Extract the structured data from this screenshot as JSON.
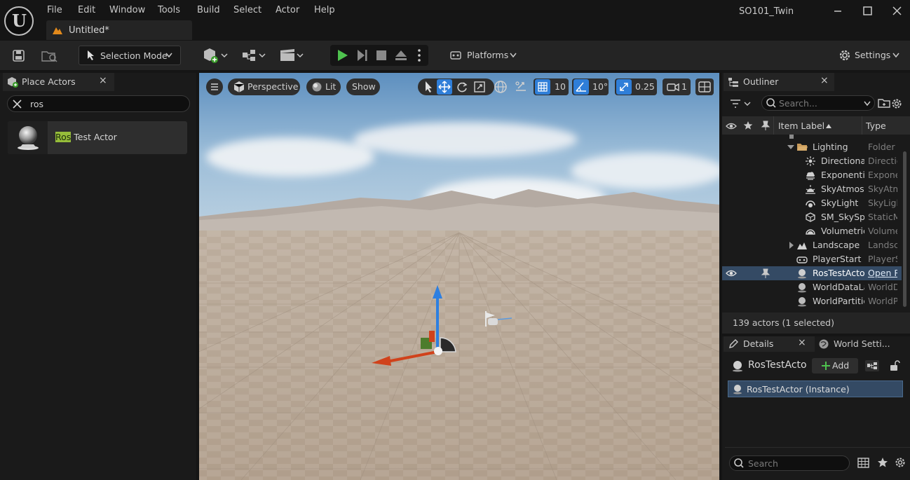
{
  "app": {
    "logo_icon": "unreal-engine-logo",
    "project_name": "SO101_Twin",
    "document_tab": "Untitled*"
  },
  "menu": [
    "File",
    "Edit",
    "Window",
    "Tools",
    "Build",
    "Select",
    "Actor",
    "Help"
  ],
  "toolbar": {
    "selection_mode": "Selection Mode",
    "platforms": "Platforms",
    "settings": "Settings"
  },
  "place_actors": {
    "tab_label": "Place Actors",
    "close": "×",
    "search_value": "ros",
    "results": [
      {
        "highlight": "Ros",
        "rest": " Test Actor"
      }
    ]
  },
  "viewport": {
    "perspective": "Perspective",
    "lit": "Lit",
    "show": "Show",
    "grid_snap": "10",
    "rotation_snap": "10°",
    "scale_snap": "0.25",
    "camera_speed": "1"
  },
  "outliner": {
    "tab_label": "Outliner",
    "close": "×",
    "search_placeholder": "Search...",
    "col_label": "Item Label",
    "col_type": "Type",
    "rows": [
      {
        "name": "Lighting",
        "type": "Folder",
        "icon": "folder-open-icon"
      },
      {
        "name": "Directiona",
        "type": "Directic",
        "icon": "directional-light-icon"
      },
      {
        "name": "Exponenti",
        "type": "Expone",
        "icon": "fog-icon"
      },
      {
        "name": "SkyAtmos",
        "type": "SkyAtm",
        "icon": "sky-atmosphere-icon"
      },
      {
        "name": "SkyLight",
        "type": "SkyLigl",
        "icon": "sky-light-icon"
      },
      {
        "name": "SM_SkySp",
        "type": "StaticM",
        "icon": "static-mesh-icon"
      },
      {
        "name": "Volumetric",
        "type": "Volume",
        "icon": "volumetric-cloud-icon"
      },
      {
        "name": "Landscape",
        "type": "Landsc",
        "icon": "landscape-icon"
      },
      {
        "name": "PlayerStart",
        "type": "PlayerS",
        "icon": "player-start-icon"
      },
      {
        "name": "RosTestActo",
        "type": "Open R",
        "icon": "actor-sphere-icon"
      },
      {
        "name": "WorldDataLa",
        "type": "WorldD",
        "icon": "actor-sphere-icon"
      },
      {
        "name": "WorldPartitic",
        "type": "WorldP",
        "icon": "actor-sphere-icon"
      }
    ],
    "status": "139 actors (1 selected)"
  },
  "details": {
    "tab_label": "Details",
    "close": "×",
    "world_settings_tab": "World Setti...",
    "actor_name": "RosTestActo",
    "add_label": "Add",
    "instance_label": "RosTestActor (Instance)",
    "search_placeholder": "Search"
  },
  "colors": {
    "accent_blue": "#2f7ed8",
    "play_green": "#4ec24e",
    "highlight_green": "#96bd3a",
    "selection_blue": "#344a64"
  }
}
